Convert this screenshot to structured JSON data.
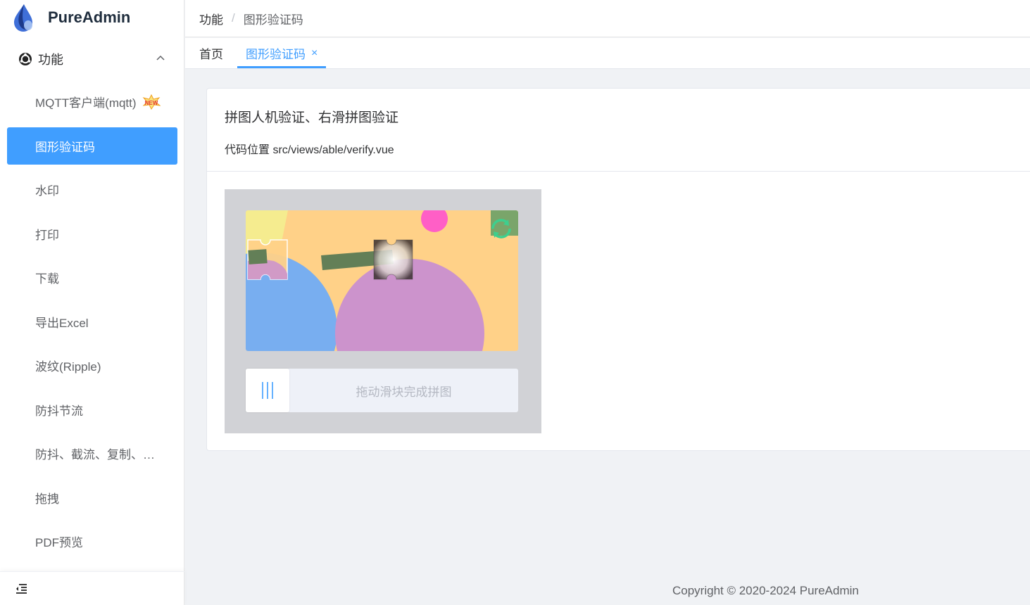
{
  "app": {
    "name": "PureAdmin"
  },
  "sidebar": {
    "group_label": "功能",
    "items": [
      {
        "label": "MQTT客户端(mqtt)",
        "badge": "NEW"
      },
      {
        "label": "图形验证码"
      },
      {
        "label": "水印"
      },
      {
        "label": "打印"
      },
      {
        "label": "下载"
      },
      {
        "label": "导出Excel"
      },
      {
        "label": "波纹(Ripple)"
      },
      {
        "label": "防抖节流"
      },
      {
        "label": "防抖、截流、复制、…"
      },
      {
        "label": "拖拽"
      },
      {
        "label": "PDF预览"
      }
    ],
    "active_index": 1
  },
  "breadcrumb": {
    "level1": "功能",
    "separator": "/",
    "level2": "图形验证码"
  },
  "tabs": [
    {
      "label": "首页"
    },
    {
      "label": "图形验证码",
      "close": "×"
    }
  ],
  "card": {
    "title": "拼图人机验证、右滑拼图验证",
    "subtitle": "代码位置 src/views/able/verify.vue"
  },
  "captcha": {
    "slider_text": "拖动滑块完成拼图"
  },
  "footer": {
    "copyright": "Copyright © 2020-2024 PureAdmin"
  },
  "colors": {
    "primary": "#409eff",
    "sidebar_bg": "#ffffff",
    "content_bg": "#f0f2f5"
  },
  "icons": {
    "logo": "droplet-logo-icon",
    "group": "ubuntu-style-circle-icon",
    "collapse": "chevron-up-icon",
    "refresh": "refresh-icon",
    "handle": "grip-lines-icon",
    "sidebar_toggle": "menu-fold-icon"
  }
}
